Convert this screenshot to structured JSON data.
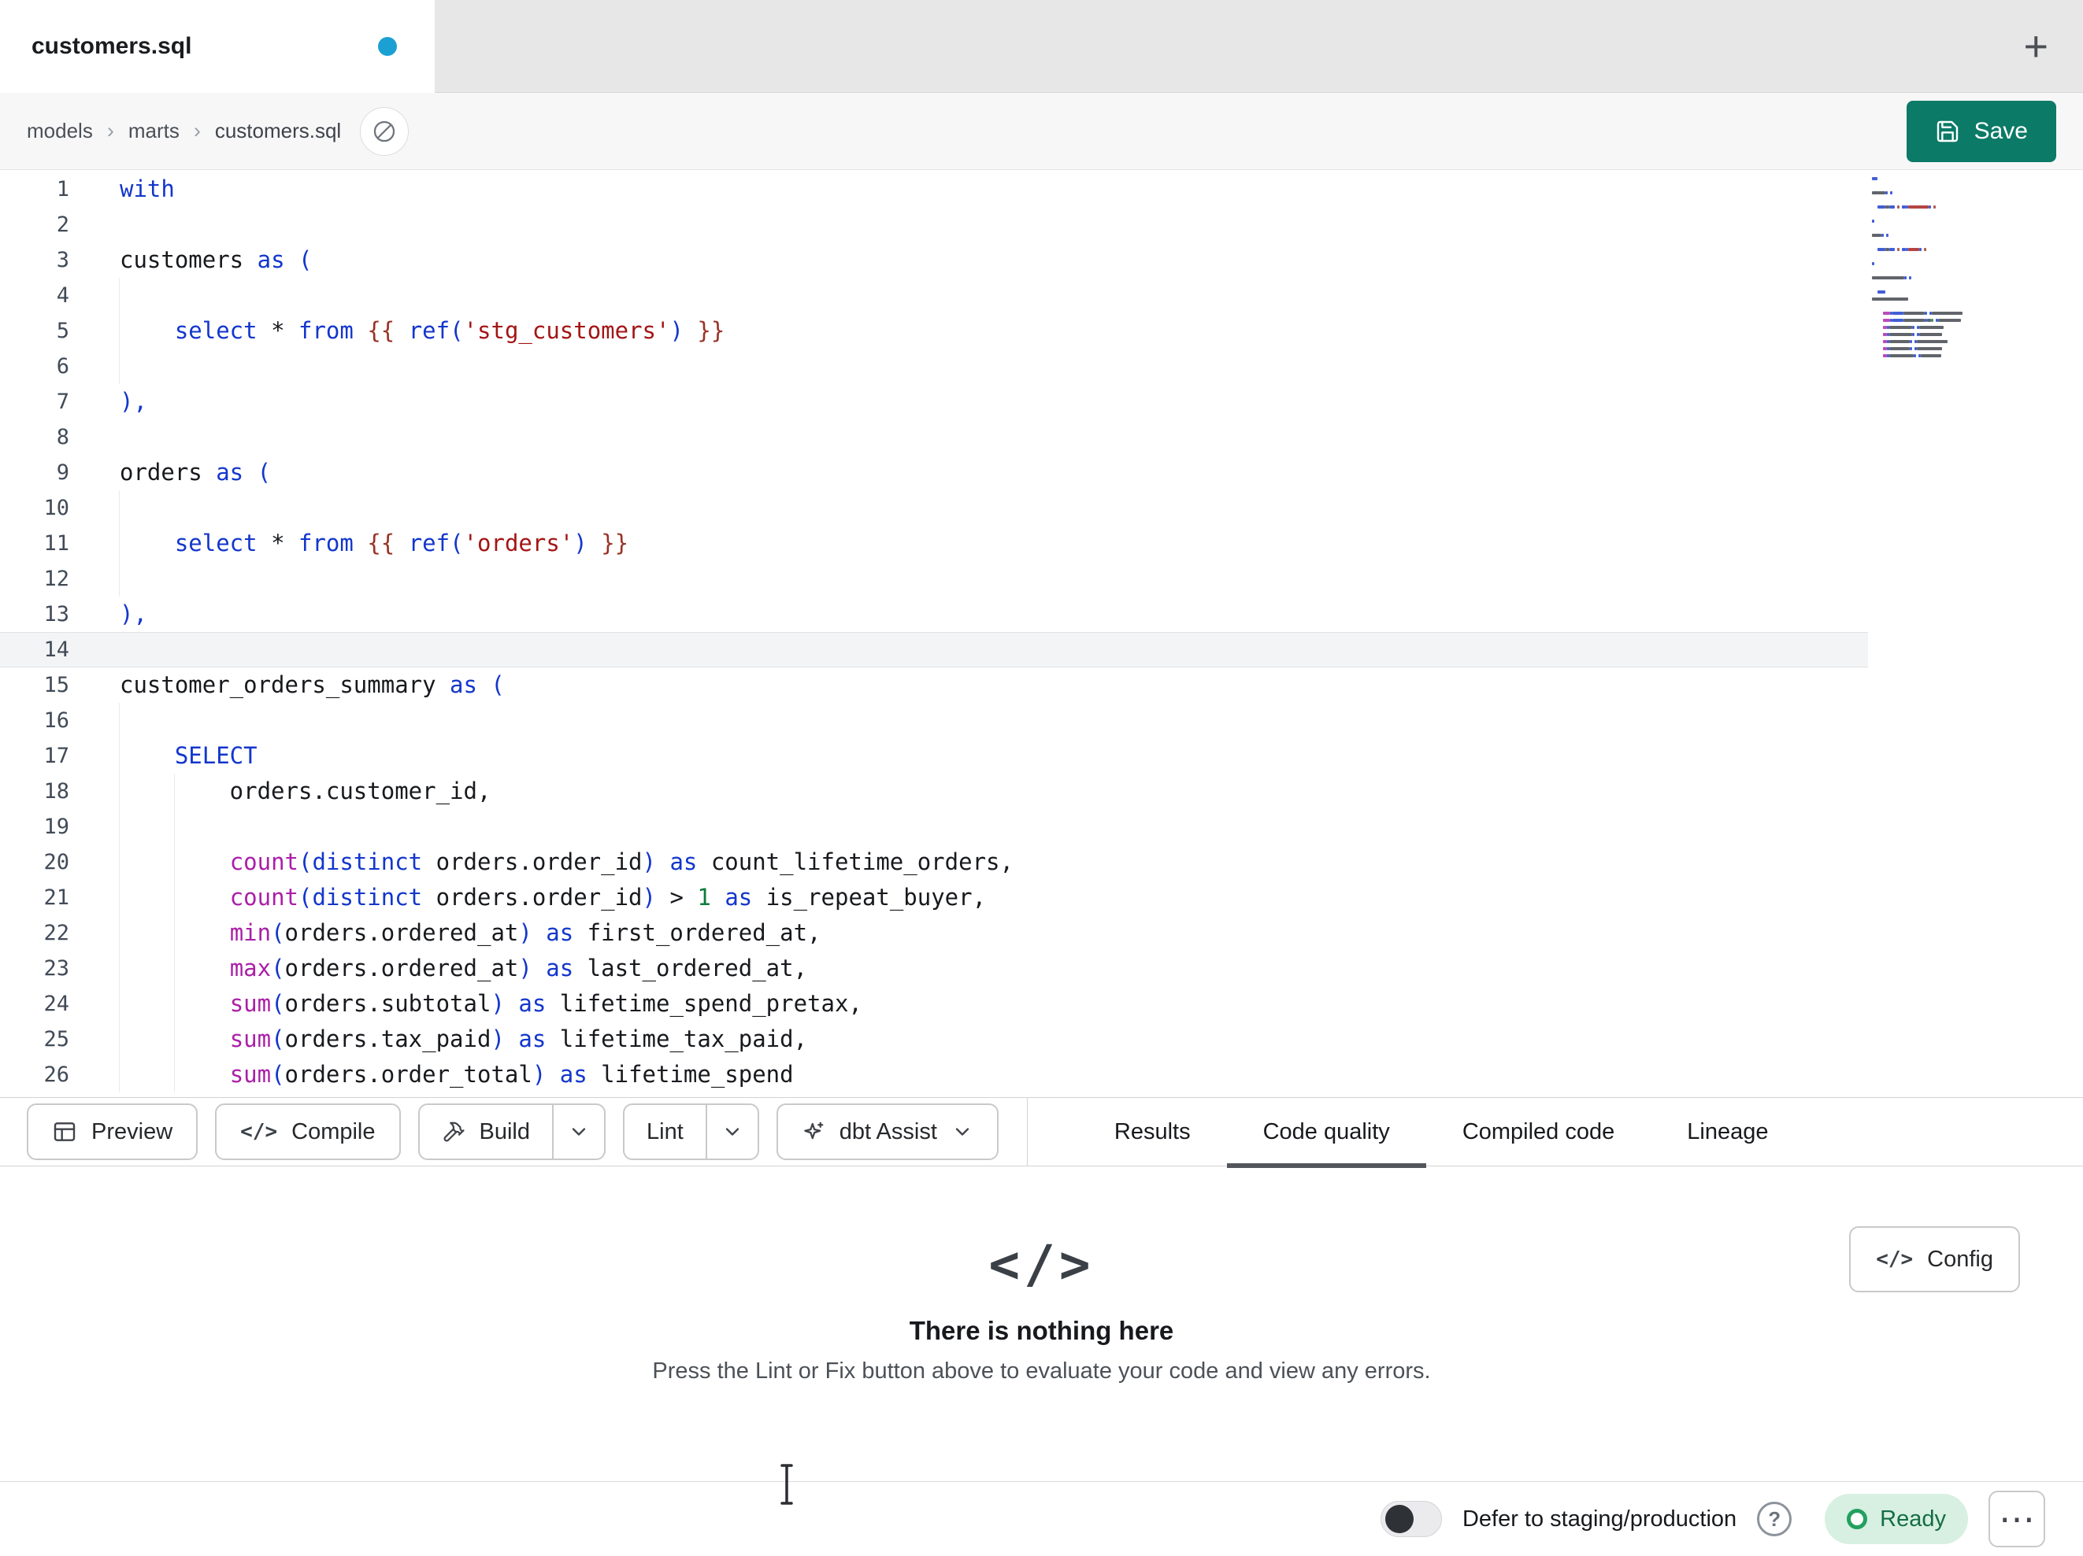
{
  "tab_bar": {
    "tabs": [
      {
        "title": "customers.sql",
        "modified": true
      }
    ]
  },
  "icons": {
    "plus": "+",
    "code_brackets": "</>",
    "ellipsis": "⋯",
    "help": "?"
  },
  "breadcrumb": {
    "items": [
      "models",
      "marts",
      "customers.sql"
    ],
    "separator": "›"
  },
  "save_button": {
    "label": "Save"
  },
  "editor": {
    "active_line": 14,
    "lines": [
      {
        "n": 1,
        "g": 0,
        "s": [
          {
            "t": "with",
            "c": "kw"
          }
        ]
      },
      {
        "n": 2,
        "g": 0,
        "s": []
      },
      {
        "n": 3,
        "g": 0,
        "s": [
          {
            "t": "customers ",
            "c": "id"
          },
          {
            "t": "as",
            "c": "kw"
          },
          {
            "t": " ",
            "c": "id"
          },
          {
            "t": "(",
            "c": "pun"
          }
        ]
      },
      {
        "n": 4,
        "g": 1,
        "s": []
      },
      {
        "n": 5,
        "g": 1,
        "s": [
          {
            "t": "    ",
            "c": "id"
          },
          {
            "t": "select",
            "c": "kw"
          },
          {
            "t": " * ",
            "c": "id"
          },
          {
            "t": "from",
            "c": "kw"
          },
          {
            "t": " ",
            "c": "id"
          },
          {
            "t": "{{",
            "c": "jinja"
          },
          {
            "t": " ",
            "c": "id"
          },
          {
            "t": "ref",
            "c": "kw"
          },
          {
            "t": "(",
            "c": "pun"
          },
          {
            "t": "'stg_customers'",
            "c": "str"
          },
          {
            "t": ")",
            "c": "pun"
          },
          {
            "t": " ",
            "c": "id"
          },
          {
            "t": "}}",
            "c": "jinja"
          }
        ]
      },
      {
        "n": 6,
        "g": 1,
        "s": []
      },
      {
        "n": 7,
        "g": 0,
        "s": [
          {
            "t": "),",
            "c": "pun"
          }
        ]
      },
      {
        "n": 8,
        "g": 0,
        "s": []
      },
      {
        "n": 9,
        "g": 0,
        "s": [
          {
            "t": "orders ",
            "c": "id"
          },
          {
            "t": "as",
            "c": "kw"
          },
          {
            "t": " ",
            "c": "id"
          },
          {
            "t": "(",
            "c": "pun"
          }
        ]
      },
      {
        "n": 10,
        "g": 1,
        "s": []
      },
      {
        "n": 11,
        "g": 1,
        "s": [
          {
            "t": "    ",
            "c": "id"
          },
          {
            "t": "select",
            "c": "kw"
          },
          {
            "t": " * ",
            "c": "id"
          },
          {
            "t": "from",
            "c": "kw"
          },
          {
            "t": " ",
            "c": "id"
          },
          {
            "t": "{{",
            "c": "jinja"
          },
          {
            "t": " ",
            "c": "id"
          },
          {
            "t": "ref",
            "c": "kw"
          },
          {
            "t": "(",
            "c": "pun"
          },
          {
            "t": "'orders'",
            "c": "str"
          },
          {
            "t": ")",
            "c": "pun"
          },
          {
            "t": " ",
            "c": "id"
          },
          {
            "t": "}}",
            "c": "jinja"
          }
        ]
      },
      {
        "n": 12,
        "g": 1,
        "s": []
      },
      {
        "n": 13,
        "g": 0,
        "s": [
          {
            "t": "),",
            "c": "pun"
          }
        ]
      },
      {
        "n": 14,
        "g": 0,
        "s": []
      },
      {
        "n": 15,
        "g": 0,
        "s": [
          {
            "t": "customer_orders_summary ",
            "c": "id"
          },
          {
            "t": "as",
            "c": "kw"
          },
          {
            "t": " ",
            "c": "id"
          },
          {
            "t": "(",
            "c": "pun"
          }
        ]
      },
      {
        "n": 16,
        "g": 1,
        "s": []
      },
      {
        "n": 17,
        "g": 1,
        "s": [
          {
            "t": "    ",
            "c": "id"
          },
          {
            "t": "SELECT",
            "c": "kw"
          }
        ]
      },
      {
        "n": 18,
        "g": 2,
        "s": [
          {
            "t": "        orders.customer_id,",
            "c": "id"
          }
        ]
      },
      {
        "n": 19,
        "g": 2,
        "s": []
      },
      {
        "n": 20,
        "g": 2,
        "s": [
          {
            "t": "        ",
            "c": "id"
          },
          {
            "t": "count",
            "c": "fn"
          },
          {
            "t": "(",
            "c": "pun"
          },
          {
            "t": "distinct",
            "c": "kw"
          },
          {
            "t": " orders.order_id",
            "c": "id"
          },
          {
            "t": ")",
            "c": "pun"
          },
          {
            "t": " ",
            "c": "id"
          },
          {
            "t": "as",
            "c": "kw"
          },
          {
            "t": " count_lifetime_orders,",
            "c": "id"
          }
        ]
      },
      {
        "n": 21,
        "g": 2,
        "s": [
          {
            "t": "        ",
            "c": "id"
          },
          {
            "t": "count",
            "c": "fn"
          },
          {
            "t": "(",
            "c": "pun"
          },
          {
            "t": "distinct",
            "c": "kw"
          },
          {
            "t": " orders.order_id",
            "c": "id"
          },
          {
            "t": ")",
            "c": "pun"
          },
          {
            "t": " > ",
            "c": "id"
          },
          {
            "t": "1",
            "c": "num"
          },
          {
            "t": " ",
            "c": "id"
          },
          {
            "t": "as",
            "c": "kw"
          },
          {
            "t": " is_repeat_buyer,",
            "c": "id"
          }
        ]
      },
      {
        "n": 22,
        "g": 2,
        "s": [
          {
            "t": "        ",
            "c": "id"
          },
          {
            "t": "min",
            "c": "fn"
          },
          {
            "t": "(",
            "c": "pun"
          },
          {
            "t": "orders.ordered_at",
            "c": "id"
          },
          {
            "t": ")",
            "c": "pun"
          },
          {
            "t": " ",
            "c": "id"
          },
          {
            "t": "as",
            "c": "kw"
          },
          {
            "t": " first_ordered_at,",
            "c": "id"
          }
        ]
      },
      {
        "n": 23,
        "g": 2,
        "s": [
          {
            "t": "        ",
            "c": "id"
          },
          {
            "t": "max",
            "c": "fn"
          },
          {
            "t": "(",
            "c": "pun"
          },
          {
            "t": "orders.ordered_at",
            "c": "id"
          },
          {
            "t": ")",
            "c": "pun"
          },
          {
            "t": " ",
            "c": "id"
          },
          {
            "t": "as",
            "c": "kw"
          },
          {
            "t": " last_ordered_at,",
            "c": "id"
          }
        ]
      },
      {
        "n": 24,
        "g": 2,
        "s": [
          {
            "t": "        ",
            "c": "id"
          },
          {
            "t": "sum",
            "c": "fn"
          },
          {
            "t": "(",
            "c": "pun"
          },
          {
            "t": "orders.subtotal",
            "c": "id"
          },
          {
            "t": ")",
            "c": "pun"
          },
          {
            "t": " ",
            "c": "id"
          },
          {
            "t": "as",
            "c": "kw"
          },
          {
            "t": " lifetime_spend_pretax,",
            "c": "id"
          }
        ]
      },
      {
        "n": 25,
        "g": 2,
        "s": [
          {
            "t": "        ",
            "c": "id"
          },
          {
            "t": "sum",
            "c": "fn"
          },
          {
            "t": "(",
            "c": "pun"
          },
          {
            "t": "orders.tax_paid",
            "c": "id"
          },
          {
            "t": ")",
            "c": "pun"
          },
          {
            "t": " ",
            "c": "id"
          },
          {
            "t": "as",
            "c": "kw"
          },
          {
            "t": " lifetime_tax_paid,",
            "c": "id"
          }
        ]
      },
      {
        "n": 26,
        "g": 2,
        "s": [
          {
            "t": "        ",
            "c": "id"
          },
          {
            "t": "sum",
            "c": "fn"
          },
          {
            "t": "(",
            "c": "pun"
          },
          {
            "t": "orders.order_total",
            "c": "id"
          },
          {
            "t": ")",
            "c": "pun"
          },
          {
            "t": " ",
            "c": "id"
          },
          {
            "t": "as",
            "c": "kw"
          },
          {
            "t": " lifetime_spend",
            "c": "id"
          }
        ]
      }
    ]
  },
  "toolbar": {
    "buttons": {
      "preview": "Preview",
      "compile": "Compile",
      "build": "Build",
      "lint": "Lint",
      "dbt_assist": "dbt Assist"
    },
    "tabs": [
      {
        "label": "Results",
        "active": false
      },
      {
        "label": "Code quality",
        "active": true
      },
      {
        "label": "Compiled code",
        "active": false
      },
      {
        "label": "Lineage",
        "active": false
      }
    ]
  },
  "panel": {
    "config_label": "Config",
    "title": "There is nothing here",
    "subtitle": "Press the Lint or Fix button above to evaluate your code and view any errors."
  },
  "status_bar": {
    "defer_label": "Defer to staging/production",
    "ready_label": "Ready"
  },
  "colors": {
    "modified_dot": "#1ba0d3",
    "save_button": "#0b7a66",
    "ready_bg": "#d7f0e2",
    "ready_text": "#156d44",
    "tab_indicator": "#53565c"
  },
  "syntax_colors": {
    "kw": "#1336cc",
    "pun": "#1336cc",
    "fn": "#aa1fa8",
    "str": "#a31515",
    "jinja": "#9a3226",
    "num": "#0e7a3d",
    "id": "#17191d"
  }
}
